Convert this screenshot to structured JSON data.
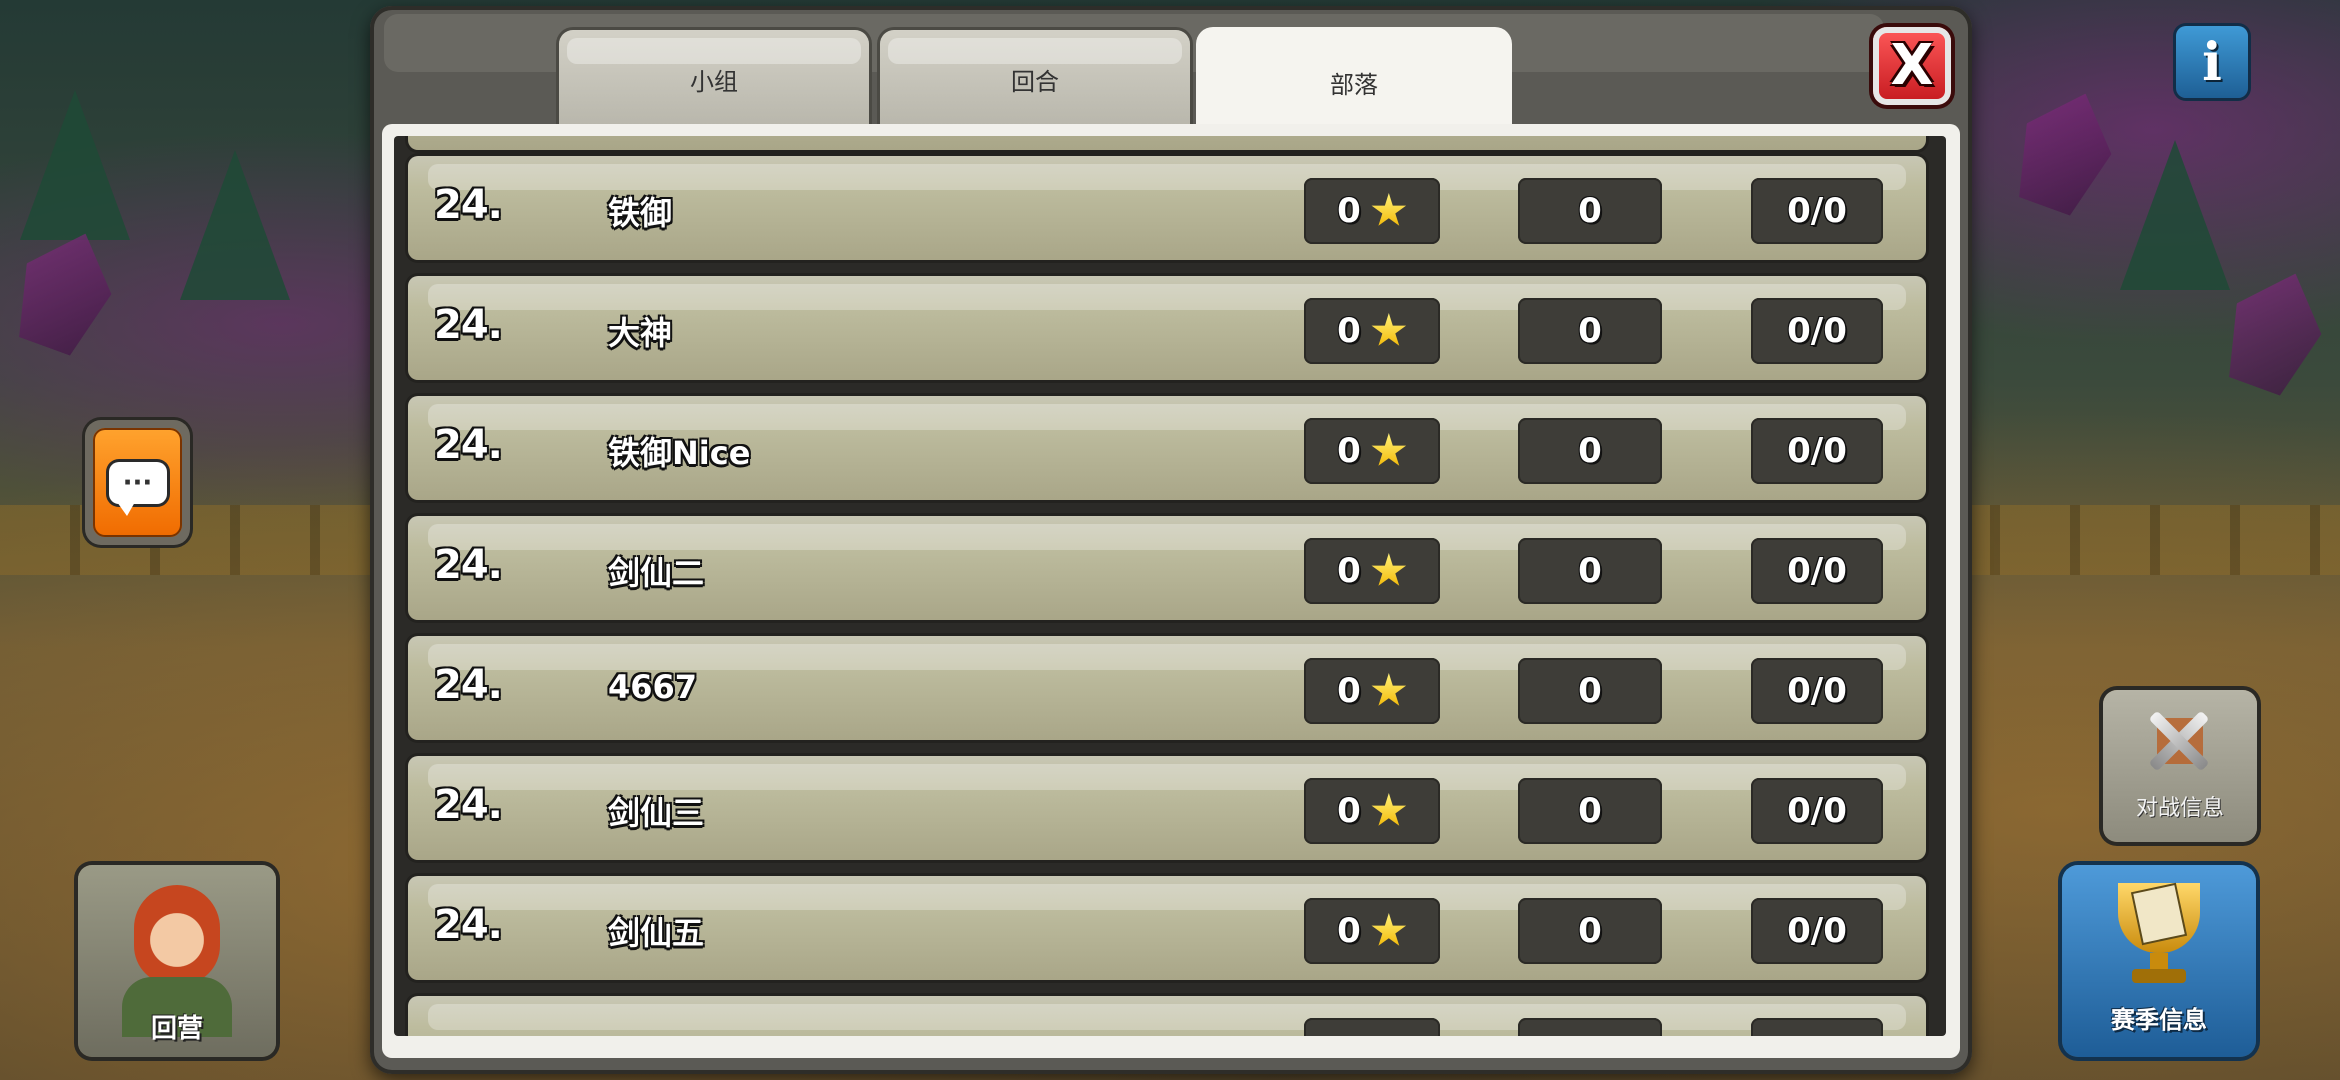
{
  "tabs": [
    {
      "label": "小组",
      "active": false
    },
    {
      "label": "回合",
      "active": false
    },
    {
      "label": "部落",
      "active": true
    }
  ],
  "close_label": "X",
  "info_label": "i",
  "rows": [
    {
      "rank": "24.",
      "name": "铁御",
      "stars": "0",
      "middle": "0",
      "ratio": "0/0"
    },
    {
      "rank": "24.",
      "name": "大神",
      "stars": "0",
      "middle": "0",
      "ratio": "0/0"
    },
    {
      "rank": "24.",
      "name": "铁御Nice",
      "stars": "0",
      "middle": "0",
      "ratio": "0/0"
    },
    {
      "rank": "24.",
      "name": "剑仙二",
      "stars": "0",
      "middle": "0",
      "ratio": "0/0"
    },
    {
      "rank": "24.",
      "name": "4667",
      "stars": "0",
      "middle": "0",
      "ratio": "0/0"
    },
    {
      "rank": "24.",
      "name": "剑仙三",
      "stars": "0",
      "middle": "0",
      "ratio": "0/0"
    },
    {
      "rank": "24.",
      "name": "剑仙五",
      "stars": "0",
      "middle": "0",
      "ratio": "0/0"
    }
  ],
  "side_buttons": {
    "chat_icon": "chat-bubble-icon",
    "chat_glyph": "···",
    "home_label": "回营",
    "battle_info_label": "对战信息",
    "season_info_label": "赛季信息"
  },
  "colors": {
    "active_tab": "#f5f4ef",
    "row": "#bdbc9e",
    "close": "#d8262b",
    "star": "#f2c200",
    "season_button": "#2f7bbf",
    "chat_button": "#f07a00"
  }
}
